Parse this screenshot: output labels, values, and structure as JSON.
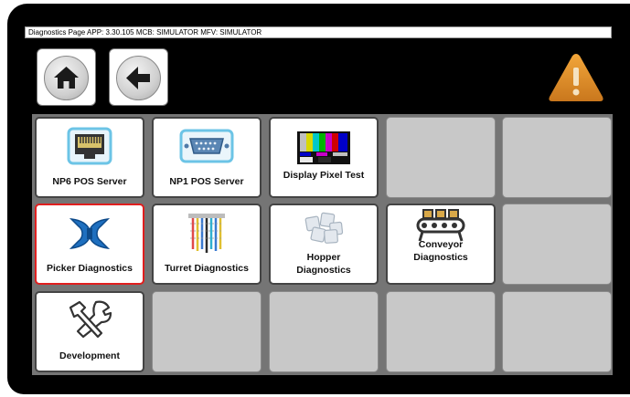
{
  "status_bar": {
    "text": "Diagnostics Page  APP: 3.30.105  MCB: SIMULATOR  MFV: SIMULATOR"
  },
  "nav": {
    "home_icon": "home-icon",
    "back_icon": "arrow-left-icon",
    "warning_icon": "warning-triangle-icon"
  },
  "colors": {
    "background": "#000000",
    "tile_bg": "#ffffff",
    "empty_tile": "#c8c8c8",
    "selected_border": "#e01e1e",
    "warning": "#e0902a"
  },
  "tiles": [
    {
      "label": "NP6 POS Server",
      "icon": "ethernet-port-icon"
    },
    {
      "label": "NP1 POS Server",
      "icon": "serial-port-icon"
    },
    {
      "label": "Display Pixel Test",
      "icon": "color-bars-icon"
    },
    {
      "label": "Picker Diagnostics",
      "icon": "gripper-icon",
      "selected": true
    },
    {
      "label": "Turret Diagnostics",
      "icon": "turret-icon"
    },
    {
      "label": "Hopper Diagnostics",
      "icon": "ice-cubes-icon"
    },
    {
      "label": "Conveyor Diagnostics",
      "icon": "conveyor-icon"
    },
    {
      "label": "Development",
      "icon": "tools-icon"
    }
  ]
}
